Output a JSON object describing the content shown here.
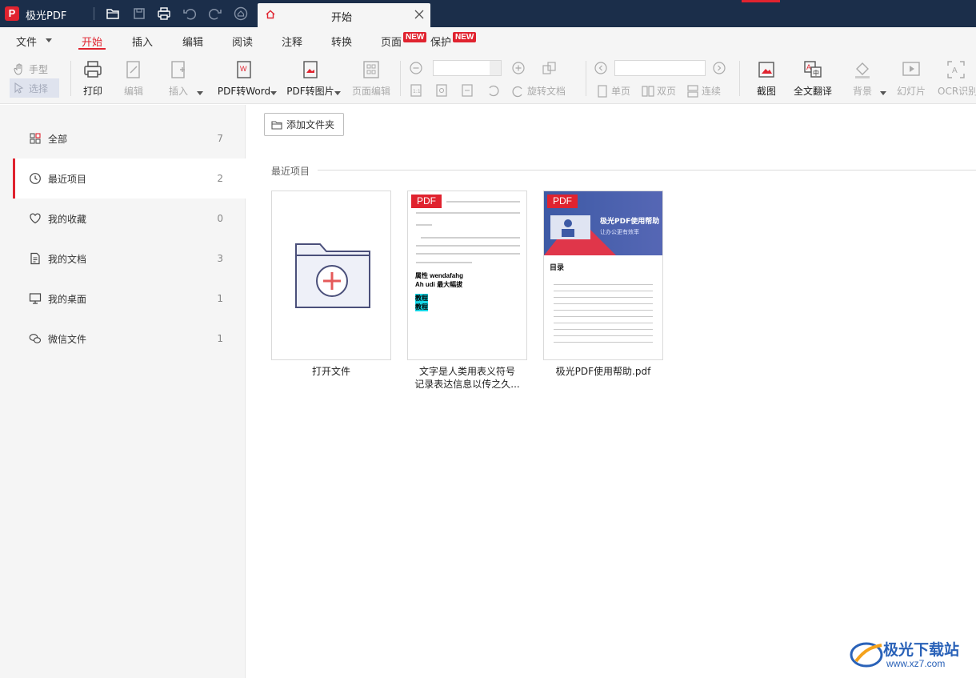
{
  "titlebar": {
    "app_logo_letter": "P",
    "app_name": "极光PDF",
    "tab_label": "开始",
    "icons": [
      "open-folder-icon",
      "save-icon",
      "print-icon",
      "undo-icon",
      "redo-icon",
      "home-icon"
    ]
  },
  "menu": {
    "items": [
      "文件",
      "开始",
      "插入",
      "编辑",
      "阅读",
      "注释",
      "转换",
      "页面",
      "保护"
    ],
    "active": "开始",
    "new_badge": "NEW"
  },
  "toolbar": {
    "hand": "手型",
    "select": "选择",
    "print": "打印",
    "edit": "编辑",
    "insert": "插入",
    "pdf_to_word": "PDF转Word",
    "pdf_to_image": "PDF转图片",
    "page_edit": "页面编辑",
    "rotate_doc": "旋转文档",
    "single_page": "单页",
    "double_page": "双页",
    "continuous": "连续",
    "screenshot": "截图",
    "full_translate": "全文翻译",
    "background": "背景",
    "slideshow": "幻灯片",
    "ocr": "OCR识别",
    "zoom_value": "",
    "page_value": ""
  },
  "sidebar": {
    "items": [
      {
        "label": "全部",
        "count": "7",
        "icon": "grid-icon"
      },
      {
        "label": "最近项目",
        "count": "2",
        "icon": "clock-icon"
      },
      {
        "label": "我的收藏",
        "count": "0",
        "icon": "heart-icon"
      },
      {
        "label": "我的文档",
        "count": "3",
        "icon": "document-icon"
      },
      {
        "label": "我的桌面",
        "count": "1",
        "icon": "monitor-icon"
      },
      {
        "label": "微信文件",
        "count": "1",
        "icon": "wechat-icon"
      }
    ],
    "active_index": 1
  },
  "main": {
    "add_folder_label": "添加文件夹",
    "section_title": "最近项目",
    "cards": [
      {
        "caption": "打开文件"
      },
      {
        "caption_line1": "文字是人类用表义符号",
        "caption_line2": "记录表达信息以传之久...",
        "pdf_tag": "PDF",
        "preview_bold1": "属性 wendafahg",
        "preview_bold2": "Ah udi 最大幅拔",
        "preview_hl1": "教程",
        "preview_hl2": "教程"
      },
      {
        "caption": "极光PDF使用帮助.pdf",
        "pdf_tag": "PDF",
        "banner_title": "极光PDF使用帮助",
        "banner_sub": "让办公更有效率",
        "toc": "目录"
      }
    ]
  },
  "watermark": {
    "text": "极光下载站",
    "url": "www.xz7.com"
  },
  "colors": {
    "accent": "#e0232f",
    "titlebar": "#1b2e4a",
    "toolbar_bg": "#f5f5f5",
    "banner": "#3d5aa5"
  }
}
